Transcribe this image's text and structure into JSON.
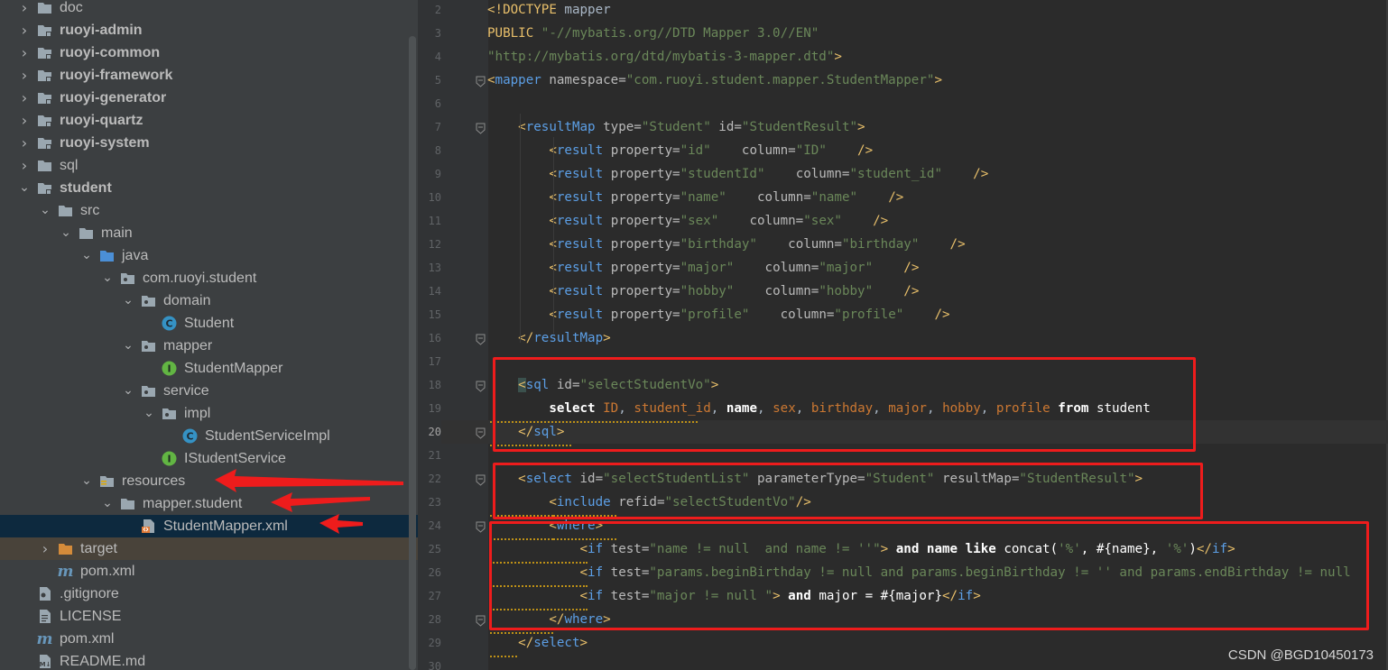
{
  "project_tree": {
    "items": [
      {
        "label": "doc",
        "icon": "folder-icon",
        "expanded": false,
        "bold": false
      },
      {
        "label": "ruoyi-admin",
        "icon": "module-folder-icon",
        "expanded": false,
        "bold": true
      },
      {
        "label": "ruoyi-common",
        "icon": "module-folder-icon",
        "expanded": false,
        "bold": true
      },
      {
        "label": "ruoyi-framework",
        "icon": "module-folder-icon",
        "expanded": false,
        "bold": true
      },
      {
        "label": "ruoyi-generator",
        "icon": "module-folder-icon",
        "expanded": false,
        "bold": true
      },
      {
        "label": "ruoyi-quartz",
        "icon": "module-folder-icon",
        "expanded": false,
        "bold": true
      },
      {
        "label": "ruoyi-system",
        "icon": "module-folder-icon",
        "expanded": false,
        "bold": true
      },
      {
        "label": "sql",
        "icon": "folder-icon",
        "expanded": false,
        "bold": false
      },
      {
        "label": "student",
        "icon": "module-folder-icon",
        "expanded": true,
        "bold": true
      },
      {
        "label": "src",
        "icon": "folder-icon",
        "expanded": true,
        "bold": false
      },
      {
        "label": "main",
        "icon": "folder-icon",
        "expanded": true,
        "bold": false
      },
      {
        "label": "java",
        "icon": "source-folder-icon",
        "expanded": true,
        "bold": false
      },
      {
        "label": "com.ruoyi.student",
        "icon": "package-icon",
        "expanded": true,
        "bold": false
      },
      {
        "label": "domain",
        "icon": "package-icon",
        "expanded": true,
        "bold": false
      },
      {
        "label": "Student",
        "icon": "class-icon",
        "expanded": null,
        "bold": false
      },
      {
        "label": "mapper",
        "icon": "package-icon",
        "expanded": true,
        "bold": false
      },
      {
        "label": "StudentMapper",
        "icon": "interface-icon",
        "expanded": null,
        "bold": false
      },
      {
        "label": "service",
        "icon": "package-icon",
        "expanded": true,
        "bold": false
      },
      {
        "label": "impl",
        "icon": "package-icon",
        "expanded": true,
        "bold": false
      },
      {
        "label": "StudentServiceImpl",
        "icon": "class-icon",
        "expanded": null,
        "bold": false
      },
      {
        "label": "IStudentService",
        "icon": "interface-icon",
        "expanded": null,
        "bold": false
      },
      {
        "label": "resources",
        "icon": "resources-folder-icon",
        "expanded": true,
        "bold": false
      },
      {
        "label": "mapper.student",
        "icon": "folder-icon",
        "expanded": true,
        "bold": false
      },
      {
        "label": "StudentMapper.xml",
        "icon": "xml-file-icon",
        "expanded": null,
        "bold": false,
        "selected": true
      },
      {
        "label": "target",
        "icon": "excluded-folder-icon",
        "expanded": false,
        "bold": false,
        "excluded": true
      },
      {
        "label": "pom.xml",
        "icon": "maven-icon",
        "expanded": null,
        "bold": false
      },
      {
        "label": ".gitignore",
        "icon": "gitignore-icon",
        "expanded": null,
        "bold": false
      },
      {
        "label": "LICENSE",
        "icon": "text-file-icon",
        "expanded": null,
        "bold": false
      },
      {
        "label": "pom.xml",
        "icon": "maven-icon",
        "expanded": null,
        "bold": false
      },
      {
        "label": "README.md",
        "icon": "markdown-icon",
        "expanded": null,
        "bold": false
      }
    ]
  },
  "editor": {
    "current_line": 20,
    "lines": [
      {
        "n": "2",
        "fold": false,
        "tokens": [
          [
            "tag",
            "<!DOCTYPE "
          ],
          [
            "plain",
            "mapper"
          ]
        ]
      },
      {
        "n": "3",
        "fold": false,
        "tokens": [
          [
            "tag",
            "PUBLIC "
          ],
          [
            "val",
            "\"-//mybatis.org//DTD Mapper 3.0//EN\""
          ]
        ]
      },
      {
        "n": "4",
        "fold": false,
        "tokens": [
          [
            "val",
            "\"http://mybatis.org/dtd/mybatis-3-mapper.dtd\""
          ],
          [
            "tag",
            ">"
          ]
        ]
      },
      {
        "n": "5",
        "fold": true,
        "tokens": [
          [
            "tag",
            "<"
          ],
          [
            "tagx",
            "mapper "
          ],
          [
            "attr",
            "namespace="
          ],
          [
            "val",
            "\"com.ruoyi.student.mapper.StudentMapper\""
          ],
          [
            "tag",
            ">"
          ]
        ]
      },
      {
        "n": "6",
        "fold": false,
        "tokens": []
      },
      {
        "n": "7",
        "fold": true,
        "tokens": [
          [
            "plain",
            "    "
          ],
          [
            "tag",
            "<"
          ],
          [
            "tagx",
            "resultMap "
          ],
          [
            "attr",
            "type="
          ],
          [
            "val",
            "\"Student\" "
          ],
          [
            "attr",
            "id="
          ],
          [
            "val",
            "\"StudentResult\""
          ],
          [
            "tag",
            ">"
          ]
        ]
      },
      {
        "n": "8",
        "fold": false,
        "tokens": [
          [
            "plain",
            "        "
          ],
          [
            "tag",
            "<"
          ],
          [
            "tagx",
            "result "
          ],
          [
            "attr",
            "property="
          ],
          [
            "val",
            "\"id\"    "
          ],
          [
            "attr",
            "column="
          ],
          [
            "val",
            "\"ID\"    "
          ],
          [
            "tag",
            "/>"
          ]
        ]
      },
      {
        "n": "9",
        "fold": false,
        "tokens": [
          [
            "plain",
            "        "
          ],
          [
            "tag",
            "<"
          ],
          [
            "tagx",
            "result "
          ],
          [
            "attr",
            "property="
          ],
          [
            "val",
            "\"studentId\"    "
          ],
          [
            "attr",
            "column="
          ],
          [
            "val",
            "\"student_id\"    "
          ],
          [
            "tag",
            "/>"
          ]
        ]
      },
      {
        "n": "10",
        "fold": false,
        "tokens": [
          [
            "plain",
            "        "
          ],
          [
            "tag",
            "<"
          ],
          [
            "tagx",
            "result "
          ],
          [
            "attr",
            "property="
          ],
          [
            "val",
            "\"name\"    "
          ],
          [
            "attr",
            "column="
          ],
          [
            "val",
            "\"name\"    "
          ],
          [
            "tag",
            "/>"
          ]
        ]
      },
      {
        "n": "11",
        "fold": false,
        "tokens": [
          [
            "plain",
            "        "
          ],
          [
            "tag",
            "<"
          ],
          [
            "tagx",
            "result "
          ],
          [
            "attr",
            "property="
          ],
          [
            "val",
            "\"sex\"    "
          ],
          [
            "attr",
            "column="
          ],
          [
            "val",
            "\"sex\"    "
          ],
          [
            "tag",
            "/>"
          ]
        ]
      },
      {
        "n": "12",
        "fold": false,
        "tokens": [
          [
            "plain",
            "        "
          ],
          [
            "tag",
            "<"
          ],
          [
            "tagx",
            "result "
          ],
          [
            "attr",
            "property="
          ],
          [
            "val",
            "\"birthday\"    "
          ],
          [
            "attr",
            "column="
          ],
          [
            "val",
            "\"birthday\"    "
          ],
          [
            "tag",
            "/>"
          ]
        ]
      },
      {
        "n": "13",
        "fold": false,
        "tokens": [
          [
            "plain",
            "        "
          ],
          [
            "tag",
            "<"
          ],
          [
            "tagx",
            "result "
          ],
          [
            "attr",
            "property="
          ],
          [
            "val",
            "\"major\"    "
          ],
          [
            "attr",
            "column="
          ],
          [
            "val",
            "\"major\"    "
          ],
          [
            "tag",
            "/>"
          ]
        ]
      },
      {
        "n": "14",
        "fold": false,
        "tokens": [
          [
            "plain",
            "        "
          ],
          [
            "tag",
            "<"
          ],
          [
            "tagx",
            "result "
          ],
          [
            "attr",
            "property="
          ],
          [
            "val",
            "\"hobby\"    "
          ],
          [
            "attr",
            "column="
          ],
          [
            "val",
            "\"hobby\"    "
          ],
          [
            "tag",
            "/>"
          ]
        ]
      },
      {
        "n": "15",
        "fold": false,
        "tokens": [
          [
            "plain",
            "        "
          ],
          [
            "tag",
            "<"
          ],
          [
            "tagx",
            "result "
          ],
          [
            "attr",
            "property="
          ],
          [
            "val",
            "\"profile\"    "
          ],
          [
            "attr",
            "column="
          ],
          [
            "val",
            "\"profile\"    "
          ],
          [
            "tag",
            "/>"
          ]
        ]
      },
      {
        "n": "16",
        "fold": true,
        "tokens": [
          [
            "plain",
            "    "
          ],
          [
            "tag",
            "</"
          ],
          [
            "tagx",
            "resultMap"
          ],
          [
            "tag",
            ">"
          ]
        ]
      },
      {
        "n": "17",
        "fold": false,
        "tokens": []
      },
      {
        "n": "18",
        "fold": true,
        "tokens": [
          [
            "plain",
            "    "
          ],
          [
            "sqlbg",
            "<"
          ],
          [
            "tagx",
            "sql "
          ],
          [
            "attr",
            "id="
          ],
          [
            "val",
            "\"selectStudentVo\""
          ],
          [
            "tag",
            ">"
          ]
        ]
      },
      {
        "n": "19",
        "fold": false,
        "tokens": [
          [
            "plain",
            "        "
          ],
          [
            "kwb",
            "select "
          ],
          [
            "col",
            "ID"
          ],
          [
            "plain",
            ", "
          ],
          [
            "col",
            "student_id"
          ],
          [
            "plain",
            ", "
          ],
          [
            "kwb",
            "name"
          ],
          [
            "plain",
            ", "
          ],
          [
            "col",
            "sex"
          ],
          [
            "plain",
            ", "
          ],
          [
            "col",
            "birthday"
          ],
          [
            "plain",
            ", "
          ],
          [
            "col",
            "major"
          ],
          [
            "plain",
            ", "
          ],
          [
            "col",
            "hobby"
          ],
          [
            "plain",
            ", "
          ],
          [
            "col",
            "profile "
          ],
          [
            "kwb",
            "from "
          ],
          [
            "white",
            "student"
          ]
        ]
      },
      {
        "n": "20",
        "fold": true,
        "tokens": [
          [
            "plain",
            "    "
          ],
          [
            "tag",
            "</"
          ],
          [
            "tagx",
            "sql"
          ],
          [
            "tag",
            ">"
          ]
        ]
      },
      {
        "n": "21",
        "fold": false,
        "tokens": []
      },
      {
        "n": "22",
        "fold": true,
        "tokens": [
          [
            "plain",
            "    "
          ],
          [
            "tag",
            "<"
          ],
          [
            "tagx",
            "select "
          ],
          [
            "attr",
            "id="
          ],
          [
            "val",
            "\"selectStudentList\" "
          ],
          [
            "attr",
            "parameterType="
          ],
          [
            "val",
            "\"Student\" "
          ],
          [
            "attr",
            "resultMap="
          ],
          [
            "val",
            "\"StudentResult\""
          ],
          [
            "tag",
            ">"
          ]
        ]
      },
      {
        "n": "23",
        "fold": false,
        "tokens": [
          [
            "plain",
            "        "
          ],
          [
            "tag",
            "<"
          ],
          [
            "tagx",
            "include "
          ],
          [
            "attr",
            "refid="
          ],
          [
            "val",
            "\"selectStudentVo\""
          ],
          [
            "tag",
            "/>"
          ]
        ]
      },
      {
        "n": "24",
        "fold": true,
        "tokens": [
          [
            "plain",
            "        "
          ],
          [
            "tag",
            "<"
          ],
          [
            "tagx",
            "where"
          ],
          [
            "tag",
            ">"
          ]
        ]
      },
      {
        "n": "25",
        "fold": false,
        "tokens": [
          [
            "plain",
            "            "
          ],
          [
            "tag",
            "<"
          ],
          [
            "tagx",
            "if "
          ],
          [
            "attr",
            "test="
          ],
          [
            "val",
            "\"name != null  and name != ''\""
          ],
          [
            "tag",
            "> "
          ],
          [
            "kwb",
            "and name like "
          ],
          [
            "white",
            "concat("
          ],
          [
            "green",
            "'%'"
          ],
          [
            "white",
            ", #{name}, "
          ],
          [
            "green",
            "'%'"
          ],
          [
            "white",
            ")"
          ],
          [
            "tag",
            "</"
          ],
          [
            "tagx",
            "if"
          ],
          [
            "tag",
            ">"
          ]
        ]
      },
      {
        "n": "26",
        "fold": false,
        "tokens": [
          [
            "plain",
            "            "
          ],
          [
            "tag",
            "<"
          ],
          [
            "tagx",
            "if "
          ],
          [
            "attr",
            "test="
          ],
          [
            "val",
            "\"params.beginBirthday != null and params.beginBirthday != '' and params.endBirthday != null"
          ]
        ]
      },
      {
        "n": "27",
        "fold": false,
        "tokens": [
          [
            "plain",
            "            "
          ],
          [
            "tag",
            "<"
          ],
          [
            "tagx",
            "if "
          ],
          [
            "attr",
            "test="
          ],
          [
            "val",
            "\"major != null \""
          ],
          [
            "tag",
            "> "
          ],
          [
            "kwb",
            "and "
          ],
          [
            "white",
            "major = #{major}"
          ],
          [
            "tag",
            "</"
          ],
          [
            "tagx",
            "if"
          ],
          [
            "tag",
            ">"
          ]
        ]
      },
      {
        "n": "28",
        "fold": true,
        "tokens": [
          [
            "plain",
            "        "
          ],
          [
            "tag",
            "</"
          ],
          [
            "tagx",
            "where"
          ],
          [
            "tag",
            ">"
          ]
        ]
      },
      {
        "n": "29",
        "fold": false,
        "tokens": [
          [
            "plain",
            "    "
          ],
          [
            "tag",
            "</"
          ],
          [
            "tagx",
            "select"
          ],
          [
            "tag",
            ">"
          ]
        ]
      },
      {
        "n": "30",
        "fold": false,
        "tokens": []
      }
    ]
  },
  "watermark": "CSDN @BGD10450173",
  "colors": {
    "tree_bg": "#3c3f41",
    "editor_bg": "#2b2b2b",
    "gutter_bg": "#313335",
    "selection": "#0d293e",
    "annotation_red": "#ee1c1c"
  }
}
